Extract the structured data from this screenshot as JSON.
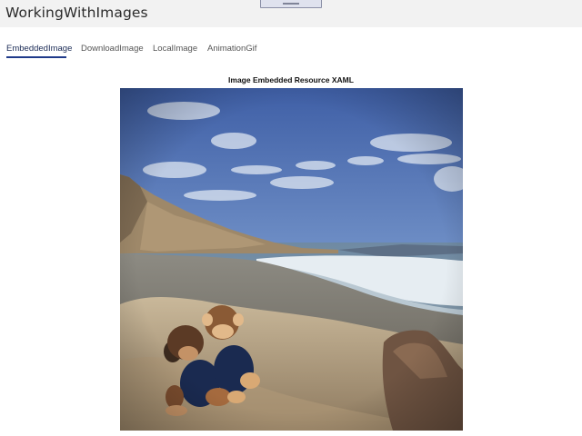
{
  "window": {
    "title": "WorkingWithImages"
  },
  "tabs": [
    {
      "label": "EmbeddedImage",
      "active": true
    },
    {
      "label": "DownloadImage",
      "active": false
    },
    {
      "label": "LocalImage",
      "active": false
    },
    {
      "label": "AnimationGif",
      "active": false
    }
  ],
  "content": {
    "heading": "Image Embedded Resource XAML"
  },
  "colors": {
    "tab_accent": "#1f3a8a",
    "titlebar_bg": "#f2f2f2"
  }
}
